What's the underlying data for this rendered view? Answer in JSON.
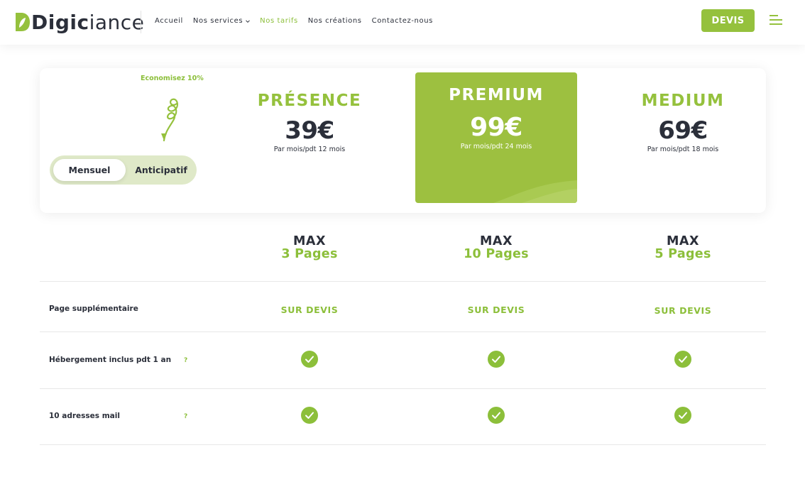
{
  "header": {
    "logo": {
      "bold": "Digic",
      "regular": "iance"
    },
    "nav": [
      {
        "label": "Accueil",
        "active": false,
        "dropdown": false
      },
      {
        "label": "Nos services",
        "active": false,
        "dropdown": true
      },
      {
        "label": "Nos tarifs",
        "active": true,
        "dropdown": false
      },
      {
        "label": "Nos créations",
        "active": false,
        "dropdown": false
      },
      {
        "label": "Contactez-nous",
        "active": false,
        "dropdown": false
      }
    ],
    "cta": "DEVIS",
    "menu_icon": "hamburger-menu-icon"
  },
  "pricing": {
    "save_text": "Economisez 10%",
    "toggle": {
      "active": "Mensuel",
      "inactive": "Anticipatif"
    },
    "plans": [
      {
        "name": "PRÉSENCE",
        "price": "39€",
        "sub": "Par mois/pdt 12 mois",
        "featured": false
      },
      {
        "name": "PREMIUM",
        "price": "99€",
        "sub": "Par mois/pdt 24 mois",
        "featured": true
      },
      {
        "name": "MEDIUM",
        "price": "69€",
        "sub": "Par mois/pdt 18 mois",
        "featured": false
      }
    ]
  },
  "features": {
    "max": [
      {
        "label": "MAX",
        "pages": "3 Pages"
      },
      {
        "label": "MAX",
        "pages": "10 Pages"
      },
      {
        "label": "MAX",
        "pages": "5 Pages"
      }
    ],
    "rows": [
      {
        "label": "Page supplémentaire",
        "help": "",
        "values": [
          "SUR DEVIS",
          "SUR DEVIS",
          "SUR DEVIS"
        ]
      },
      {
        "label": "Hébergement inclus pdt 1 an",
        "help": "?",
        "values": [
          "check",
          "check",
          "check"
        ]
      },
      {
        "label": "10 adresses mail",
        "help": "?",
        "values": [
          "check",
          "check",
          "check"
        ]
      }
    ]
  },
  "colors": {
    "accent": "#95c13d",
    "text": "#2b2f3a",
    "toggle_bg": "#dfe9c8"
  }
}
